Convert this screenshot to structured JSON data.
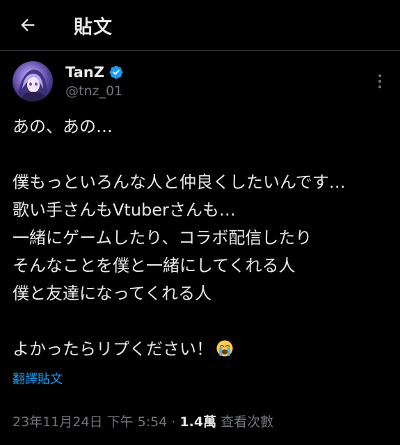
{
  "header": {
    "title": "貼文"
  },
  "author": {
    "display_name": "TanZ",
    "handle": "@tnz_01",
    "verified_icon": "verified-badge-icon"
  },
  "post": {
    "lines": [
      "あの、あの…",
      "",
      "僕もっといろんな人と仲良くしたいんです…",
      "歌い手さんもVtuberさんも…",
      "一緒にゲームしたり、コラボ配信したり",
      "そんなことを僕と一緒にしてくれる人",
      "僕と友達になってくれる人",
      "",
      "よかったらリプください！"
    ],
    "emoji": "loudly-crying-face-emoji"
  },
  "translate_label": "翻譯貼文",
  "meta": {
    "timestamp": "23年11月24日 下午 5:54",
    "separator": " · ",
    "views_count": "1.4萬",
    "views_label": " 查看次數"
  },
  "colors": {
    "background": "#000000",
    "text": "#e7e9ea",
    "muted": "#71767b",
    "accent": "#1d9bf0",
    "divider": "#2f3336"
  }
}
